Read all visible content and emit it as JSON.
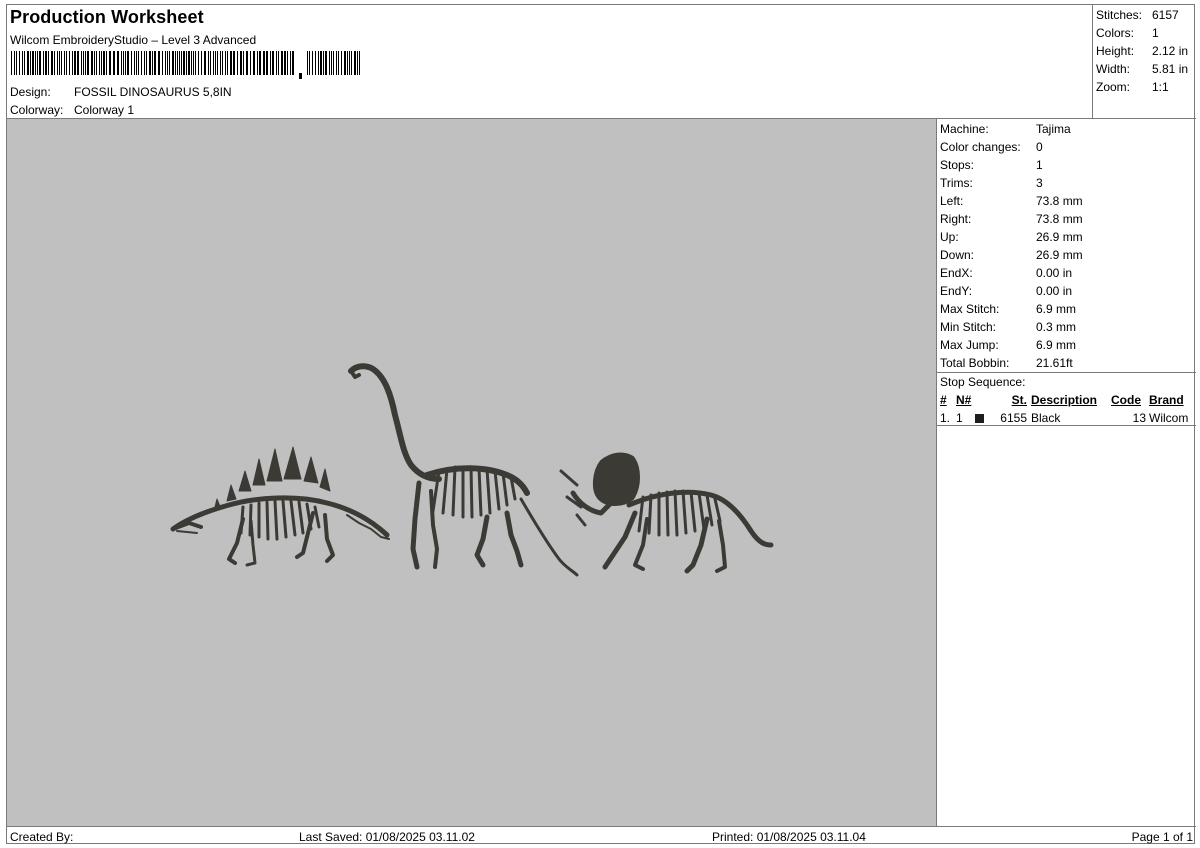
{
  "header": {
    "title": "Production Worksheet",
    "subtitle": "Wilcom EmbroideryStudio – Level 3 Advanced",
    "design_label": "Design:",
    "design_value": "FOSSIL DINOSAURUS 5,8IN",
    "colorway_label": "Colorway:",
    "colorway_value": "Colorway 1"
  },
  "summary": [
    {
      "label": "Stitches:",
      "value": "6157"
    },
    {
      "label": "Colors:",
      "value": "1"
    },
    {
      "label": "Height:",
      "value": "2.12 in"
    },
    {
      "label": "Width:",
      "value": "5.81 in"
    },
    {
      "label": "Zoom:",
      "value": "1:1"
    }
  ],
  "stats": [
    {
      "label": "Machine:",
      "value": "Tajima"
    },
    {
      "label": "Color changes:",
      "value": "0"
    },
    {
      "label": "Stops:",
      "value": "1"
    },
    {
      "label": "Trims:",
      "value": "3"
    },
    {
      "label": "Left:",
      "value": "73.8 mm"
    },
    {
      "label": "Right:",
      "value": "73.8 mm"
    },
    {
      "label": "Up:",
      "value": "26.9 mm"
    },
    {
      "label": "Down:",
      "value": "26.9 mm"
    },
    {
      "label": "EndX:",
      "value": "0.00 in"
    },
    {
      "label": "EndY:",
      "value": "0.00 in"
    },
    {
      "label": "Max Stitch:",
      "value": "6.9 mm"
    },
    {
      "label": "Min Stitch:",
      "value": "0.3 mm"
    },
    {
      "label": "Max Jump:",
      "value": "6.9 mm"
    },
    {
      "label": "Total Bobbin:",
      "value": "21.61ft"
    }
  ],
  "stop_sequence": {
    "caption": "Stop Sequence:",
    "headers": {
      "num": "#",
      "n": "N#",
      "st": "St.",
      "description": "Description",
      "code": "Code",
      "brand": "Brand"
    },
    "rows": [
      {
        "num": "1.",
        "n": "1",
        "swatch_color": "#1e1e1e",
        "st": "6155",
        "description": "Black",
        "code": "13",
        "brand": "Wilcom"
      }
    ]
  },
  "footer": {
    "created_by": "Created By:",
    "last_saved": "Last Saved: 01/08/2025 03.11.02",
    "printed": "Printed: 01/08/2025 03.11.04",
    "page": "Page 1 of 1"
  },
  "colors": {
    "canvas_bg": "#c0c0c0",
    "thread": "#3c3a35",
    "thread_highlight": "#5a5750"
  }
}
